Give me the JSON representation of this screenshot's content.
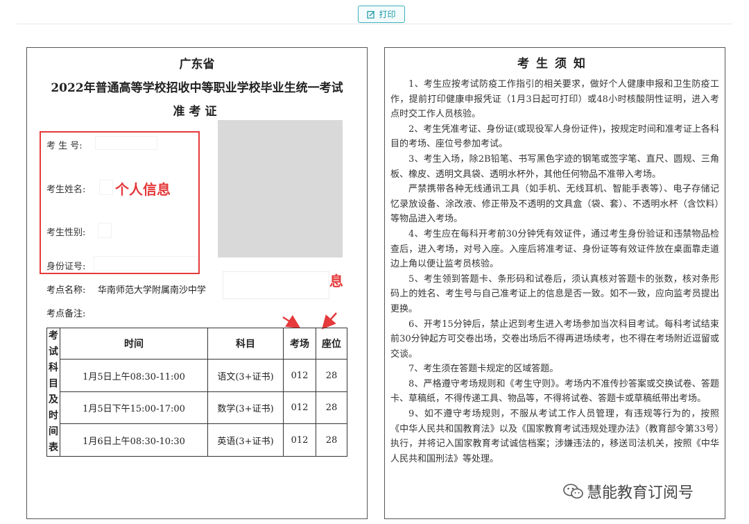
{
  "toolbar": {
    "print_label": "打印",
    "print_icon": "edit-icon"
  },
  "admit_card": {
    "province": "广东省",
    "exam_title": "2022年普通高等学校招收中等职业学校毕业生统一考试",
    "card_title": "准考证",
    "fields": {
      "candidate_no_label": "考 生 号:",
      "name_label": "考生姓名:",
      "gender_label": "考生性别:",
      "id_label": "身份证号:"
    },
    "exam_site_label": "考点名称:",
    "exam_site_value": "华南师范大学附属南沙中学",
    "exam_note_label": "考点备注:",
    "annotations": {
      "personal": "个人信息",
      "exam": "考场信息"
    },
    "schedule": {
      "side_label": [
        "考",
        "试",
        "科",
        "目",
        "及",
        "时",
        "间",
        "表"
      ],
      "headers": [
        "时间",
        "科目",
        "考场",
        "座位"
      ],
      "rows": [
        {
          "time": "1月5日上午08:30-11:00",
          "subject": "语文(3+证书)",
          "room": "012",
          "seat": "28"
        },
        {
          "time": "1月5日下午15:00-17:00",
          "subject": "数学(3+证书)",
          "room": "012",
          "seat": "28"
        },
        {
          "time": "1月6日上午08:30-10:30",
          "subject": "英语(3+证书)",
          "room": "012",
          "seat": "28"
        }
      ]
    }
  },
  "notice": {
    "title": "考生须知",
    "paragraphs": [
      "1、考生应按考试防疫工作指引的相关要求，做好个人健康申报和卫生防疫工作，提前打印健康申报凭证（1月3日起可打印）或48小时核酸阴性证明，进入考点时交工作人员核验。",
      "2、考生凭准考证、身份证(或现役军人身份证件)，按规定时间和准考证上各科目的考场、座位号参加考试。",
      "3、考生入场，除2B铅笔、书写黑色字迹的钢笔或签字笔、直尺、圆规、三角板、橡皮、透明文具袋、透明水杯外，其他任何物品不准带入考场。",
      "严禁携带各种无线通讯工具（如手机、无线耳机、智能手表等）、电子存储记忆录放设备、涂改液、修正带及不透明的文具盒（袋、套）、不透明水杯（含饮料）等物品进入考场。",
      "4、考生应在每科开考前30分钟凭有效证件，通过考生身份验证和违禁物品检查后，进入考场，对号入座。入座后将准考证、身份证等有效证件放在桌面靠走道边上角以便让监考员核验。",
      "5、考生领到答题卡、条形码和试卷后，须认真核对答题卡的张数，核对条形码上的姓名、考生号与自己准考证上的信息是否一致。如不一致，应向监考员提出更换。",
      "6、开考15分钟后，禁止迟到考生进入考场参加当次科目考试。每科考试结束前30分钟起方可交卷出场，交卷出场后不得再进场续考，也不得在考场附近逗留或交谈。",
      "7、考生须在答题卡规定的区域答题。",
      "8、严格遵守考场规则和《考生守则》。考场内不准传抄答案或交换试卷、答题卡、草稿纸，不得传递工具、物品等，不得将试卷、答题卡或草稿纸带出考场。",
      "9、如不遵守考场规则，不服从考试工作人员管理，有违规等行为的，按照《中华人民共和国教育法》以及《国家教育考试违规处理办法》（教育部令第33号）执行，并将记入国家教育考试诚信档案；涉嫌违法的，移送司法机关，按照《中华人民共和国刑法》等处理。"
    ]
  },
  "watermark": {
    "text": "慧能教育订阅号",
    "icon": "wechat-icon"
  },
  "colors": {
    "annotation_red": "#e5393b",
    "print_teal": "#1a97a6"
  }
}
